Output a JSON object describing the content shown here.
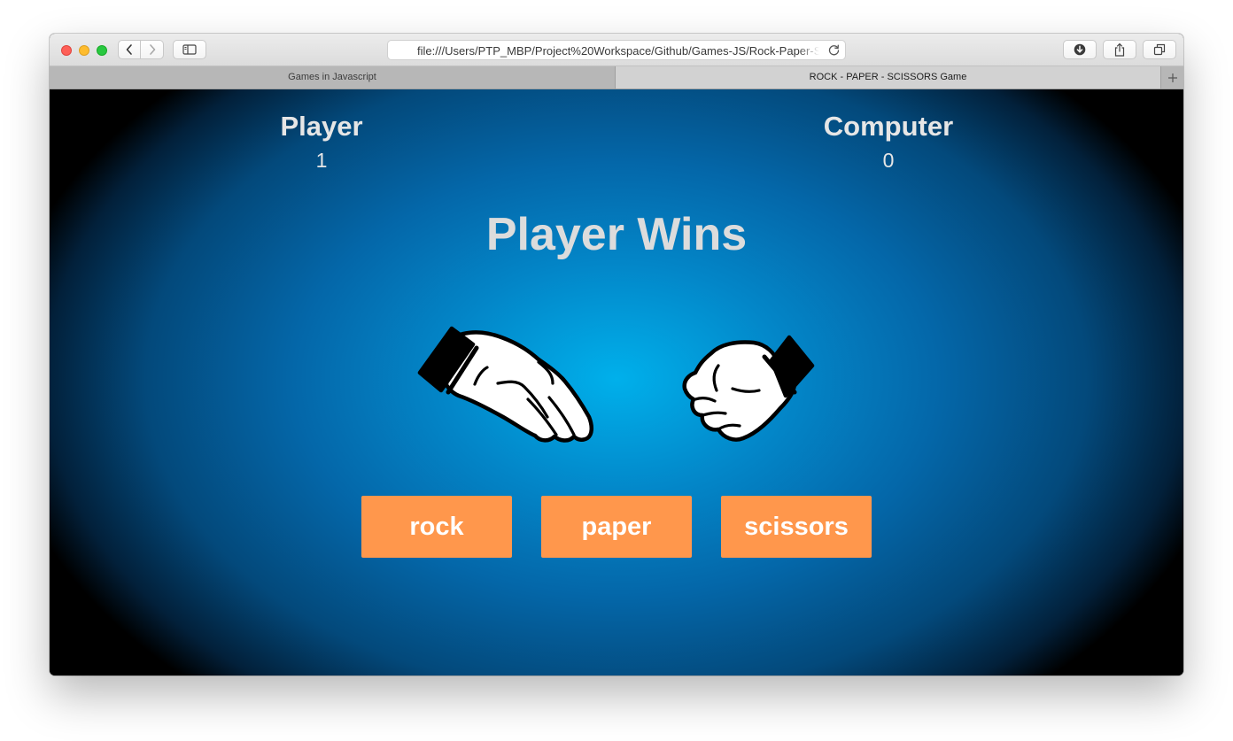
{
  "browser": {
    "url": "file:///Users/PTP_MBP/Project%20Workspace/Github/Games-JS/Rock-Paper-Scissors/index.html",
    "tabs": [
      {
        "title": "Games in Javascript",
        "active": false
      },
      {
        "title": "ROCK - PAPER - SCISSORS Game",
        "active": true
      }
    ],
    "icons": {
      "back": "chevron-left-icon",
      "forward": "chevron-right-icon",
      "sidebar": "sidebar-icon",
      "reload": "reload-icon",
      "downloads": "download-icon",
      "share": "share-icon",
      "tabs": "tabs-overview-icon",
      "new_tab": "plus-icon"
    }
  },
  "game": {
    "player": {
      "label": "Player",
      "score": "1"
    },
    "computer": {
      "label": "Computer",
      "score": "0"
    },
    "result": "Player Wins",
    "player_hand": "paper-hand-icon",
    "computer_hand": "rock-hand-icon",
    "choices": [
      {
        "label": "rock"
      },
      {
        "label": "paper"
      },
      {
        "label": "scissors"
      }
    ]
  },
  "colors": {
    "button": "#ff974c",
    "text": "#e6e6e6",
    "background_center": "#00b0eb",
    "background_edge": "#000000"
  }
}
